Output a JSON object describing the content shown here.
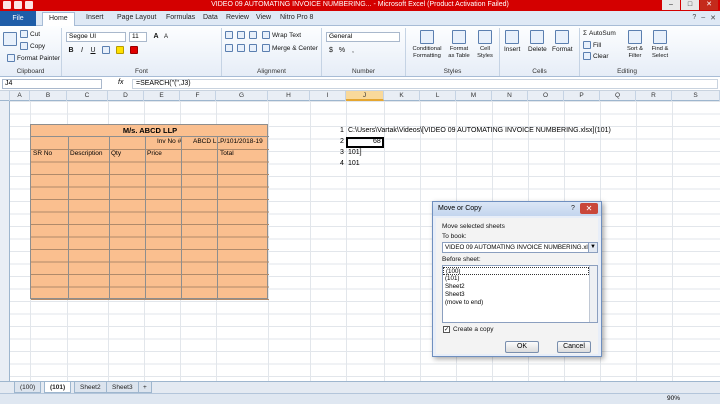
{
  "window": {
    "title": "VIDEO 09 AUTOMATING INVOICE NUMBERING... - Microsoft Excel (Product Activation Failed)",
    "controls": [
      "–",
      "□",
      "✕"
    ]
  },
  "tabs": {
    "file": "File",
    "items": [
      "Home",
      "Insert",
      "Page Layout",
      "Formulas",
      "Data",
      "Review",
      "View",
      "Nitro Pro 8"
    ]
  },
  "ribbon": {
    "clipboard": {
      "cut": "Cut",
      "copy": "Copy",
      "format_painter": "Format Painter",
      "label": "Clipboard"
    },
    "font": {
      "name": "Segoe UI",
      "size": "11",
      "bold": "B",
      "italic": "I",
      "underline": "U",
      "label": "Font",
      "grow": "A",
      "shrink": "A"
    },
    "alignment": {
      "wrap": "Wrap Text",
      "merge": "Merge & Center",
      "label": "Alignment"
    },
    "number": {
      "format": "General",
      "currency": "$",
      "percent": "%",
      "comma": ",",
      "label": "Number"
    },
    "styles": {
      "conditional": "Conditional Formatting",
      "format_table": "Format as Table",
      "cell_styles": "Cell Styles",
      "label": "Styles"
    },
    "cells": {
      "insert": "Insert",
      "delete": "Delete",
      "format": "Format",
      "label": "Cells"
    },
    "editing": {
      "autosum": "AutoSum",
      "fill": "Fill",
      "clear": "Clear",
      "sort": "Sort & Filter",
      "find": "Find & Select",
      "label": "Editing"
    }
  },
  "formula_bar": {
    "name_box": "J4",
    "fx": "fx",
    "formula": "=SEARCH(\"(\",J3)"
  },
  "columns": [
    "A",
    "B",
    "C",
    "D",
    "E",
    "F",
    "G",
    "H",
    "I",
    "J",
    "K",
    "L",
    "M",
    "N",
    "O",
    "P",
    "Q",
    "R",
    "S"
  ],
  "invoice": {
    "title": "M/s. ABCD LLP",
    "inv_no_label": "Inv No #",
    "inv_no_value": "ABCD LLP/101/2018-19",
    "headers": [
      "SR No",
      "Description",
      "Qty",
      "Price",
      "Total"
    ]
  },
  "i_col": [
    "1",
    "2",
    "3",
    "4"
  ],
  "j_col": [
    "C:\\Users\\Vartak\\Videos\\[VIDEO 09 AUTOMATING INVOICE NUMBERING.xlsx](101)",
    "68",
    "101]",
    "101"
  ],
  "sheet_tabs": [
    "(100)",
    "(101)",
    "Sheet2",
    "Sheet3"
  ],
  "status": {
    "zoom": "90%"
  },
  "dialog": {
    "title": "Move or Copy",
    "help": "?",
    "close": "✕",
    "move_label": "Move selected sheets",
    "to_book_label": "To book:",
    "to_book_value": "VIDEO 09 AUTOMATING INVOICE NUMBERING.xlsx",
    "before_label": "Before sheet:",
    "sheets": [
      "(100)",
      "(101)",
      "Sheet2",
      "Sheet3",
      "(move to end)"
    ],
    "create_copy": "Create a copy",
    "ok": "OK",
    "cancel": "Cancel"
  }
}
